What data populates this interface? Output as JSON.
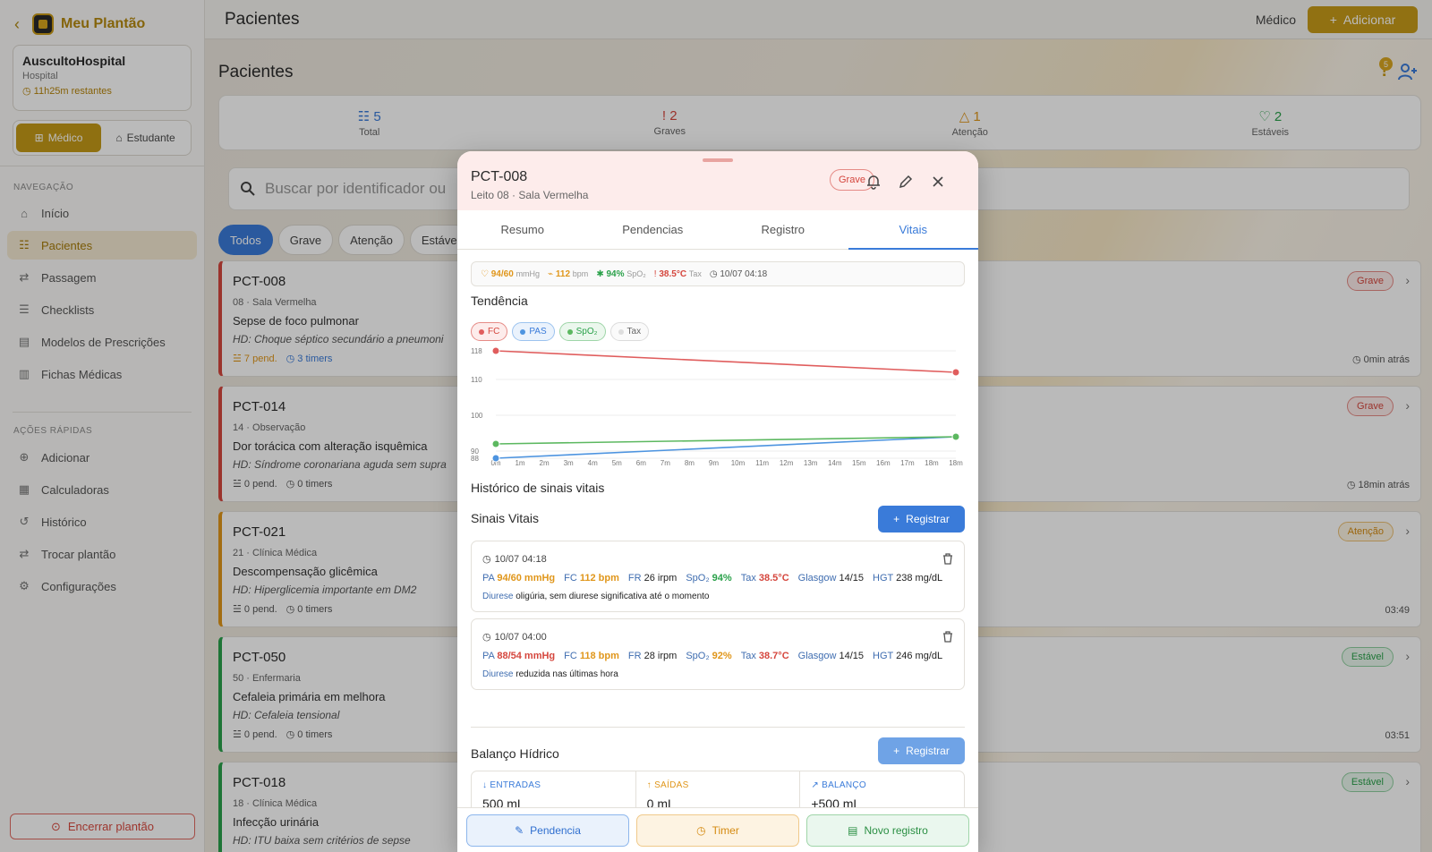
{
  "sidebar": {
    "brand": "Meu Plantão",
    "hospital": {
      "name": "AuscultoHospital",
      "type": "Hospital",
      "remaining": "11h25m restantes"
    },
    "roles": [
      {
        "label": "Médico"
      },
      {
        "label": "Estudante"
      }
    ],
    "nav_title": "NAVEGAÇÃO",
    "nav": [
      {
        "label": "Início"
      },
      {
        "label": "Pacientes"
      },
      {
        "label": "Passagem"
      },
      {
        "label": "Checklists"
      },
      {
        "label": "Modelos de Prescrições"
      },
      {
        "label": "Fichas Médicas"
      }
    ],
    "quick_title": "AÇÕES RÁPIDAS",
    "quick": [
      {
        "label": "Adicionar"
      },
      {
        "label": "Calculadoras"
      },
      {
        "label": "Histórico"
      },
      {
        "label": "Trocar plantão"
      },
      {
        "label": "Configurações"
      }
    ],
    "end_label": "Encerrar plantão"
  },
  "topbar": {
    "title": "Pacientes",
    "role": "Médico",
    "add_label": "Adicionar"
  },
  "page": {
    "title": "Pacientes",
    "alert_count": "5"
  },
  "stats": [
    {
      "value": "5",
      "label": "Total",
      "color": "#3a7bd9"
    },
    {
      "value": "2",
      "label": "Graves",
      "color": "#d5463d"
    },
    {
      "value": "1",
      "label": "Atenção",
      "color": "#e0961a"
    },
    {
      "value": "2",
      "label": "Estáveis",
      "color": "#2aa14a"
    }
  ],
  "search": {
    "placeholder": "Buscar por identificador ou"
  },
  "filters": [
    "Todos",
    "Grave",
    "Atenção",
    "Estável"
  ],
  "patients": [
    {
      "id": "PCT-008",
      "bed": "08 · Sala Vermelha",
      "diagnosis": "Sepse de foco pulmonar",
      "hd": "HD: Choque séptico secundário a pneumoni",
      "pend": "7 pend.",
      "timers": "3 timers",
      "status": "Grave",
      "time": "0min atrás"
    },
    {
      "id": "PCT-014",
      "bed": "14 · Observação",
      "diagnosis": "Dor torácica com alteração isquêmica",
      "hd": "HD: Síndrome coronariana aguda sem supra",
      "pend": "0 pend.",
      "timers": "0 timers",
      "status": "Grave",
      "time": "18min atrás"
    },
    {
      "id": "PCT-021",
      "bed": "21 · Clínica Médica",
      "diagnosis": "Descompensação glicêmica",
      "hd": "HD: Hiperglicemia importante em DM2",
      "pend": "0 pend.",
      "timers": "0 timers",
      "status": "Atenção",
      "time": "03:49"
    },
    {
      "id": "PCT-050",
      "bed": "50 · Enfermaria",
      "diagnosis": "Cefaleia primária em melhora",
      "hd": "HD: Cefaleia tensional",
      "pend": "0 pend.",
      "timers": "0 timers",
      "status": "Estável",
      "time": "03:51"
    },
    {
      "id": "PCT-018",
      "bed": "18 · Clínica Médica",
      "diagnosis": "Infecção urinária",
      "hd": "HD: ITU baixa sem critérios de sepse",
      "pend": "0 pend.",
      "timers": "0 timers",
      "status": "Estável",
      "time": ""
    }
  ],
  "modal": {
    "id": "PCT-008",
    "location": "Leito 08 · Sala Vermelha",
    "status": "Grave",
    "tabs": [
      "Resumo",
      "Pendencias",
      "Registro",
      "Vitais"
    ],
    "latest": {
      "pa": "94/60",
      "pa_unit": "mmHg",
      "fc": "112",
      "fc_unit": "bpm",
      "spo2": "94%",
      "spo2_unit": "SpO₂",
      "tax": "38.5°C",
      "tax_unit": "Tax",
      "time": "10/07 04:18"
    },
    "trend_title": "Tendência",
    "legend": [
      "FC",
      "PAS",
      "SpO₂",
      "Tax"
    ],
    "history_title": "Histórico de sinais vitais",
    "vitals_title": "Sinais Vitais",
    "register_label": "Registrar",
    "records": [
      {
        "time": "10/07 04:18",
        "pa": "94/60 mmHg",
        "fc": "112 bpm",
        "fr": "26 irpm",
        "spo2": "94%",
        "tax": "38.5°C",
        "glasgow": "14/15",
        "hgt": "238 mg/dL",
        "diurese": "oligúria, sem diurese significativa até o momento"
      },
      {
        "time": "10/07 04:00",
        "pa": "88/54 mmHg",
        "fc": "118 bpm",
        "fr": "28 irpm",
        "spo2": "92%",
        "tax": "38.7°C",
        "glasgow": "14/15",
        "hgt": "246 mg/dL",
        "diurese": "reduzida nas últimas hora"
      }
    ],
    "labels": {
      "pa": "PA",
      "fc": "FC",
      "fr": "FR",
      "spo2": "SpO₂",
      "tax": "Tax",
      "glasgow": "Glasgow",
      "hgt": "HGT",
      "diurese": "Diurese"
    },
    "balance_title": "Balanço Hídrico",
    "balance": [
      {
        "label": "ENTRADAS",
        "value": "500 mL"
      },
      {
        "label": "SAÍDAS",
        "value": "0 mL"
      },
      {
        "label": "BALANÇO",
        "value": "+500 mL"
      }
    ],
    "footer": [
      "Pendencia",
      "Timer",
      "Novo registro"
    ]
  },
  "chart_data": {
    "type": "line",
    "title": "Tendência",
    "x": [
      "0m",
      "1m",
      "2m",
      "3m",
      "4m",
      "5m",
      "6m",
      "7m",
      "8m",
      "9m",
      "10m",
      "11m",
      "12m",
      "13m",
      "14m",
      "15m",
      "16m",
      "17m",
      "18m",
      "18m"
    ],
    "yticks": [
      88,
      90,
      100,
      110,
      118
    ],
    "ylim": [
      88,
      118
    ],
    "series": [
      {
        "name": "FC",
        "color": "#e05d5d",
        "points": [
          [
            0,
            118
          ],
          [
            18,
            112
          ]
        ]
      },
      {
        "name": "PAS",
        "color": "#4d94e0",
        "points": [
          [
            0,
            88
          ],
          [
            18,
            94
          ]
        ]
      },
      {
        "name": "SpO₂",
        "color": "#5cb860",
        "points": [
          [
            0,
            92
          ],
          [
            18,
            94
          ]
        ]
      }
    ],
    "grid": true
  }
}
